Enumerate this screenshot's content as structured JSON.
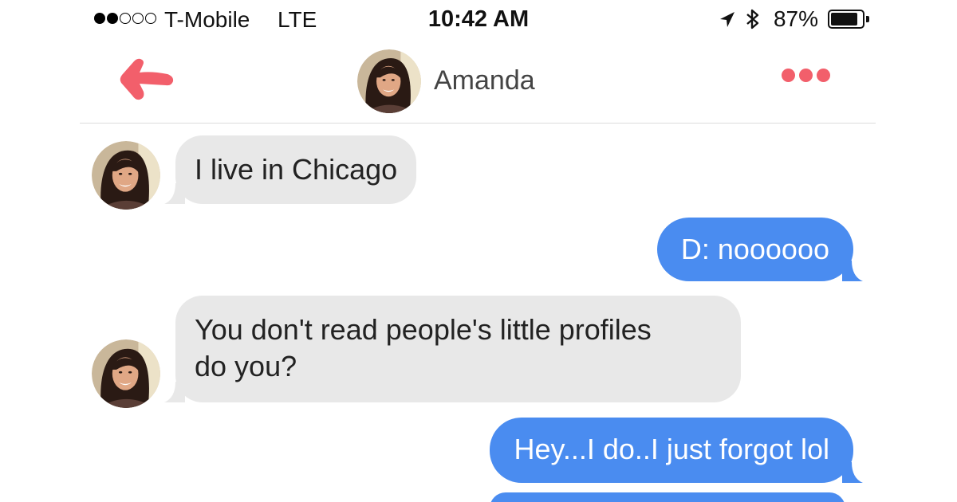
{
  "status_bar": {
    "signal_bars": {
      "filled": 2,
      "total": 5
    },
    "carrier": "T-Mobile",
    "network": "LTE",
    "time": "10:42 AM",
    "battery_percent": "87%",
    "battery_level": 0.87,
    "icons": [
      "location-arrow-icon",
      "bluetooth-icon",
      "battery-icon"
    ]
  },
  "header": {
    "back_icon": "back-arrow-icon",
    "contact_name": "Amanda",
    "more_icon": "more-dots-icon"
  },
  "messages": [
    {
      "direction": "incoming",
      "text": "I live in Chicago"
    },
    {
      "direction": "outgoing",
      "text": "D: noooooo"
    },
    {
      "direction": "incoming",
      "text": "You don't read people's little profiles\ndo you?"
    },
    {
      "direction": "outgoing",
      "text": "Hey...I do..I just forgot lol"
    }
  ],
  "colors": {
    "accent": "#f25f6b",
    "outgoing_bubble": "#4a8cf0",
    "incoming_bubble": "#e8e8e8",
    "divider": "#dcdcdc"
  }
}
